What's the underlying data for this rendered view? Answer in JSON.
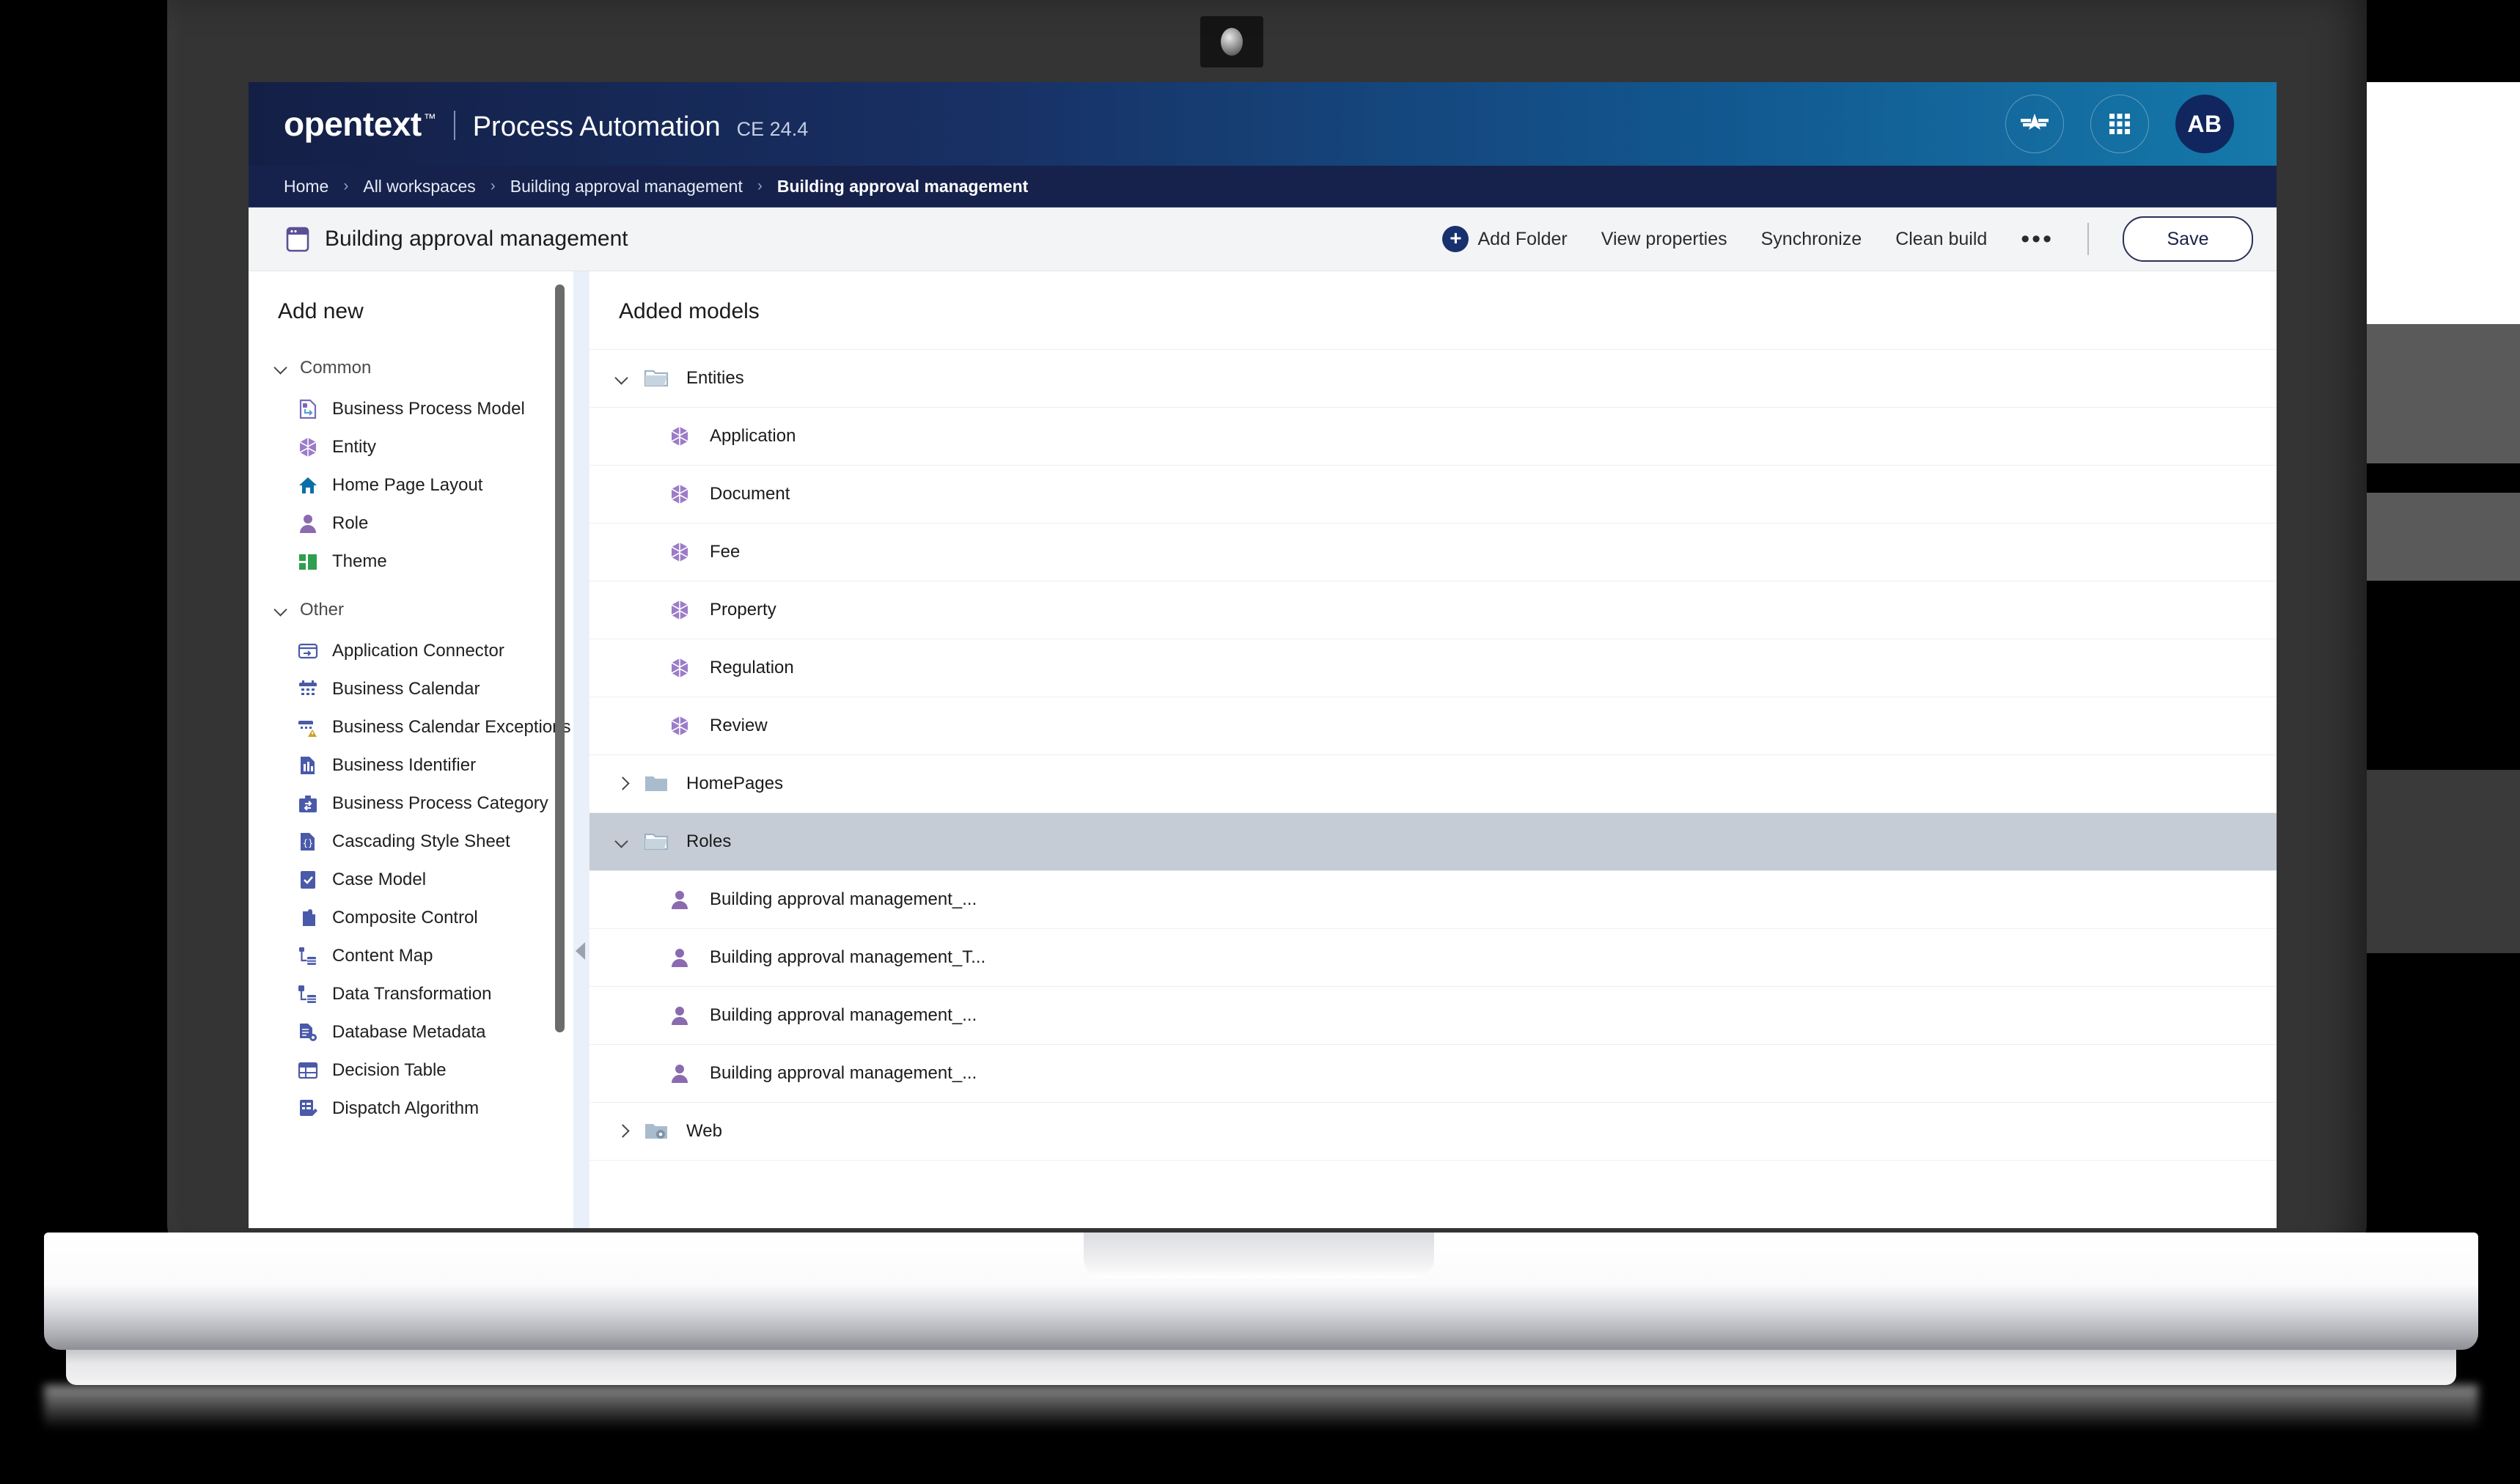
{
  "header": {
    "brand_name": "opentext",
    "brand_tm": "™",
    "app_name": "Process Automation",
    "version": "CE 24.4",
    "icons": {
      "assistant": "aviator-star-icon",
      "apps": "app-grid-icon",
      "avatar_initials": "AB"
    }
  },
  "breadcrumb": {
    "separator": "›",
    "items": [
      {
        "label": "Home"
      },
      {
        "label": "All workspaces"
      },
      {
        "label": "Building approval management"
      },
      {
        "label": "Building approval management"
      }
    ]
  },
  "toolbar": {
    "workspace_title": "Building approval management",
    "add_folder_label": "Add Folder",
    "add_folder_glyph": "+",
    "view_properties_label": "View properties",
    "synchronize_label": "Synchronize",
    "clean_build_label": "Clean build",
    "overflow_glyph": "•••",
    "save_label": "Save"
  },
  "sidebar": {
    "title": "Add new",
    "groups": [
      {
        "label": "Common",
        "expanded": true,
        "items": [
          {
            "label": "Business Process Model",
            "icon": "process-model-icon",
            "color": "#7a6bb5"
          },
          {
            "label": "Entity",
            "icon": "entity-cube-icon",
            "color": "#9b7cc8"
          },
          {
            "label": "Home Page Layout",
            "icon": "home-icon",
            "color": "#0b6ea8"
          },
          {
            "label": "Role",
            "icon": "role-person-icon",
            "color": "#8a6bb0"
          },
          {
            "label": "Theme",
            "icon": "theme-blocks-icon",
            "color": "#2e9e4f"
          }
        ]
      },
      {
        "label": "Other",
        "expanded": true,
        "items": [
          {
            "label": "Application Connector",
            "icon": "application-connector-icon",
            "color": "#4a5aa8"
          },
          {
            "label": "Business Calendar",
            "icon": "calendar-icon",
            "color": "#4a5aa8"
          },
          {
            "label": "Business Calendar Exceptions",
            "icon": "calendar-exception-icon",
            "color": "#4a5aa8"
          },
          {
            "label": "Business Identifier",
            "icon": "business-identifier-icon",
            "color": "#4a5aa8"
          },
          {
            "label": "Business Process Category",
            "icon": "process-category-icon",
            "color": "#4a5aa8"
          },
          {
            "label": "Cascading Style Sheet",
            "icon": "css-file-icon",
            "color": "#4a5aa8"
          },
          {
            "label": "Case Model",
            "icon": "case-model-icon",
            "color": "#4a5aa8"
          },
          {
            "label": "Composite Control",
            "icon": "puzzle-piece-icon",
            "color": "#4a5aa8"
          },
          {
            "label": "Content Map",
            "icon": "content-map-icon",
            "color": "#4a5aa8"
          },
          {
            "label": "Data Transformation",
            "icon": "data-transformation-icon",
            "color": "#4a5aa8"
          },
          {
            "label": "Database Metadata",
            "icon": "database-metadata-icon",
            "color": "#4a5aa8"
          },
          {
            "label": "Decision Table",
            "icon": "decision-table-icon",
            "color": "#4a5aa8"
          },
          {
            "label": "Dispatch Algorithm",
            "icon": "dispatch-algorithm-icon",
            "color": "#4a5aa8"
          }
        ]
      }
    ]
  },
  "content": {
    "title": "Added models",
    "tree": [
      {
        "label": "Entities",
        "type": "folder",
        "expanded": true,
        "selected": false,
        "icon": "folder-open-icon"
      },
      {
        "label": "Application",
        "type": "entity",
        "indent": 1,
        "icon": "entity-cube-icon"
      },
      {
        "label": "Document",
        "type": "entity",
        "indent": 1,
        "icon": "entity-cube-icon"
      },
      {
        "label": "Fee",
        "type": "entity",
        "indent": 1,
        "icon": "entity-cube-icon"
      },
      {
        "label": "Property",
        "type": "entity",
        "indent": 1,
        "icon": "entity-cube-icon"
      },
      {
        "label": "Regulation",
        "type": "entity",
        "indent": 1,
        "icon": "entity-cube-icon"
      },
      {
        "label": "Review",
        "type": "entity",
        "indent": 1,
        "icon": "entity-cube-icon"
      },
      {
        "label": "HomePages",
        "type": "folder",
        "expanded": false,
        "selected": false,
        "icon": "folder-closed-icon"
      },
      {
        "label": "Roles",
        "type": "folder",
        "expanded": true,
        "selected": true,
        "icon": "folder-open-icon"
      },
      {
        "label": "Building approval management_...",
        "type": "role",
        "indent": 1,
        "icon": "role-person-icon"
      },
      {
        "label": "Building approval management_T...",
        "type": "role",
        "indent": 1,
        "icon": "role-person-icon"
      },
      {
        "label": "Building approval management_...",
        "type": "role",
        "indent": 1,
        "icon": "role-person-icon"
      },
      {
        "label": "Building approval management_...",
        "type": "role",
        "indent": 1,
        "icon": "role-person-icon"
      },
      {
        "label": "Web",
        "type": "folder",
        "expanded": false,
        "selected": false,
        "icon": "folder-gear-icon"
      }
    ]
  },
  "colors": {
    "header_gradient_start": "#141f46",
    "header_gradient_end": "#1579aa",
    "breadcrumb_bg": "#16224c",
    "toolbar_bg": "#f3f4f5",
    "selected_row": "#c6ccd6",
    "accent_navy": "#18316e",
    "entity_purple": "#9b7cc8",
    "other_icon_blue": "#4a5aa8"
  }
}
